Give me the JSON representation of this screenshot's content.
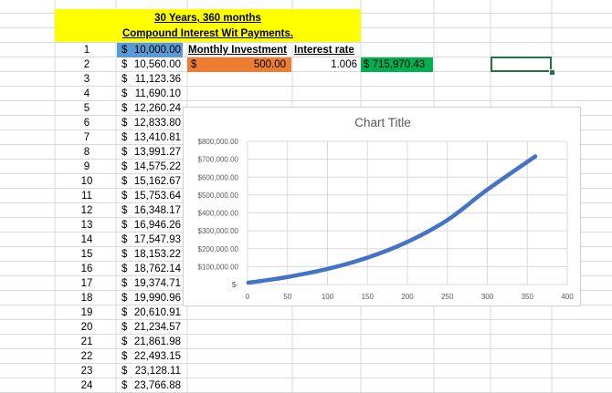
{
  "sheet": {
    "title_line1": "30 Years, 360 months",
    "title_line2": "Compound Interest Wit Payments.",
    "header_monthly": "Monthly Investment",
    "header_rate": "Interest rate",
    "monthly_currency": "$",
    "monthly_value": "500.00",
    "rate_value": "1.006",
    "result_value": "$ 715,970.43",
    "currency_symbol": "$",
    "rows": [
      {
        "n": "1",
        "amount": "10,000.00"
      },
      {
        "n": "2",
        "amount": "10,560.00"
      },
      {
        "n": "3",
        "amount": "11,123.36"
      },
      {
        "n": "4",
        "amount": "11,690.10"
      },
      {
        "n": "5",
        "amount": "12,260.24"
      },
      {
        "n": "6",
        "amount": "12,833.80"
      },
      {
        "n": "7",
        "amount": "13,410.81"
      },
      {
        "n": "8",
        "amount": "13,991.27"
      },
      {
        "n": "9",
        "amount": "14,575.22"
      },
      {
        "n": "10",
        "amount": "15,162.67"
      },
      {
        "n": "11",
        "amount": "15,753.64"
      },
      {
        "n": "12",
        "amount": "16,348.17"
      },
      {
        "n": "13",
        "amount": "16,946.26"
      },
      {
        "n": "14",
        "amount": "17,547.93"
      },
      {
        "n": "15",
        "amount": "18,153.22"
      },
      {
        "n": "16",
        "amount": "18,762.14"
      },
      {
        "n": "17",
        "amount": "19,374.71"
      },
      {
        "n": "18",
        "amount": "19,990.96"
      },
      {
        "n": "19",
        "amount": "20,610.91"
      },
      {
        "n": "20",
        "amount": "21,234.57"
      },
      {
        "n": "21",
        "amount": "21,861.98"
      },
      {
        "n": "22",
        "amount": "22,493.15"
      },
      {
        "n": "23",
        "amount": "23,128.11"
      },
      {
        "n": "24",
        "amount": "23,766.88"
      }
    ],
    "colors": {
      "banner": "#ffff00",
      "first_amount_fill": "#5b9bd5",
      "monthly_fill": "#ed7d31",
      "result_fill": "#00b050",
      "selection": "#217346",
      "gridline": "#d9d9d9"
    }
  },
  "chart_data": {
    "type": "line",
    "title": "Chart Title",
    "x_ticks": [
      "0",
      "50",
      "100",
      "150",
      "200",
      "250",
      "300",
      "350",
      "400"
    ],
    "y_ticks": [
      "$-",
      "$100,000.00",
      "$200,000.00",
      "$300,000.00",
      "$400,000.00",
      "$500,000.00",
      "$600,000.00",
      "$700,000.00",
      "$800,000.00"
    ],
    "xlim": [
      0,
      400
    ],
    "ylim": [
      0,
      800000
    ],
    "grid": true,
    "series": [
      {
        "color": "#4472c4",
        "points": [
          [
            1,
            10000
          ],
          [
            24,
            23767
          ],
          [
            50,
            42000
          ],
          [
            100,
            87000
          ],
          [
            150,
            150000
          ],
          [
            200,
            238000
          ],
          [
            250,
            360000
          ],
          [
            300,
            530000
          ],
          [
            360,
            715970
          ]
        ]
      }
    ]
  }
}
